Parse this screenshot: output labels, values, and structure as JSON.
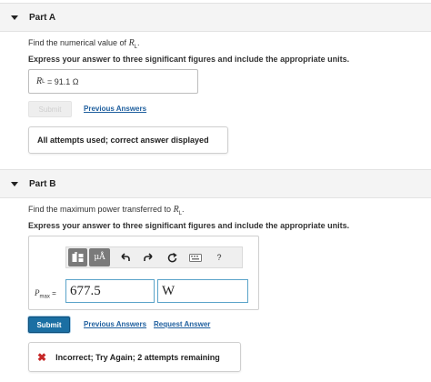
{
  "partA": {
    "title": "Part A",
    "prompt_text": "Find the numerical value of ",
    "prompt_var": "R",
    "prompt_sub": "L",
    "prompt_end": ".",
    "instruction": "Express your answer to three significant figures and include the appropriate units.",
    "answer_var": "R",
    "answer_sub": "L",
    "answer_eq": " = ",
    "answer_value": "91.1 Ω",
    "submit_label": "Submit",
    "previous_answers_label": "Previous Answers",
    "feedback": "All attempts used; correct answer displayed"
  },
  "partB": {
    "title": "Part B",
    "prompt_text": "Find the maximum power transferred to ",
    "prompt_var": "R",
    "prompt_sub": "L",
    "prompt_end": ".",
    "instruction": "Express your answer to three significant figures and include the appropriate units.",
    "toolbar": {
      "templates_icon": "templates-icon",
      "units_label": "μÅ",
      "undo_icon": "undo-icon",
      "redo_icon": "redo-icon",
      "reset_icon": "reset-icon",
      "keyboard_icon": "keyboard-icon",
      "help_label": "?"
    },
    "pmax_var": "P",
    "pmax_sub": "max",
    "pmax_eq": " =",
    "value": "677.5",
    "units": "W",
    "submit_label": "Submit",
    "previous_answers_label": "Previous Answers",
    "request_answer_label": "Request Answer",
    "feedback": "Incorrect; Try Again; 2 attempts remaining"
  },
  "colors": {
    "link": "#1f5f9e",
    "submit_bg": "#1b6fa3",
    "error": "#c62828",
    "input_border": "#5aa3c9"
  }
}
